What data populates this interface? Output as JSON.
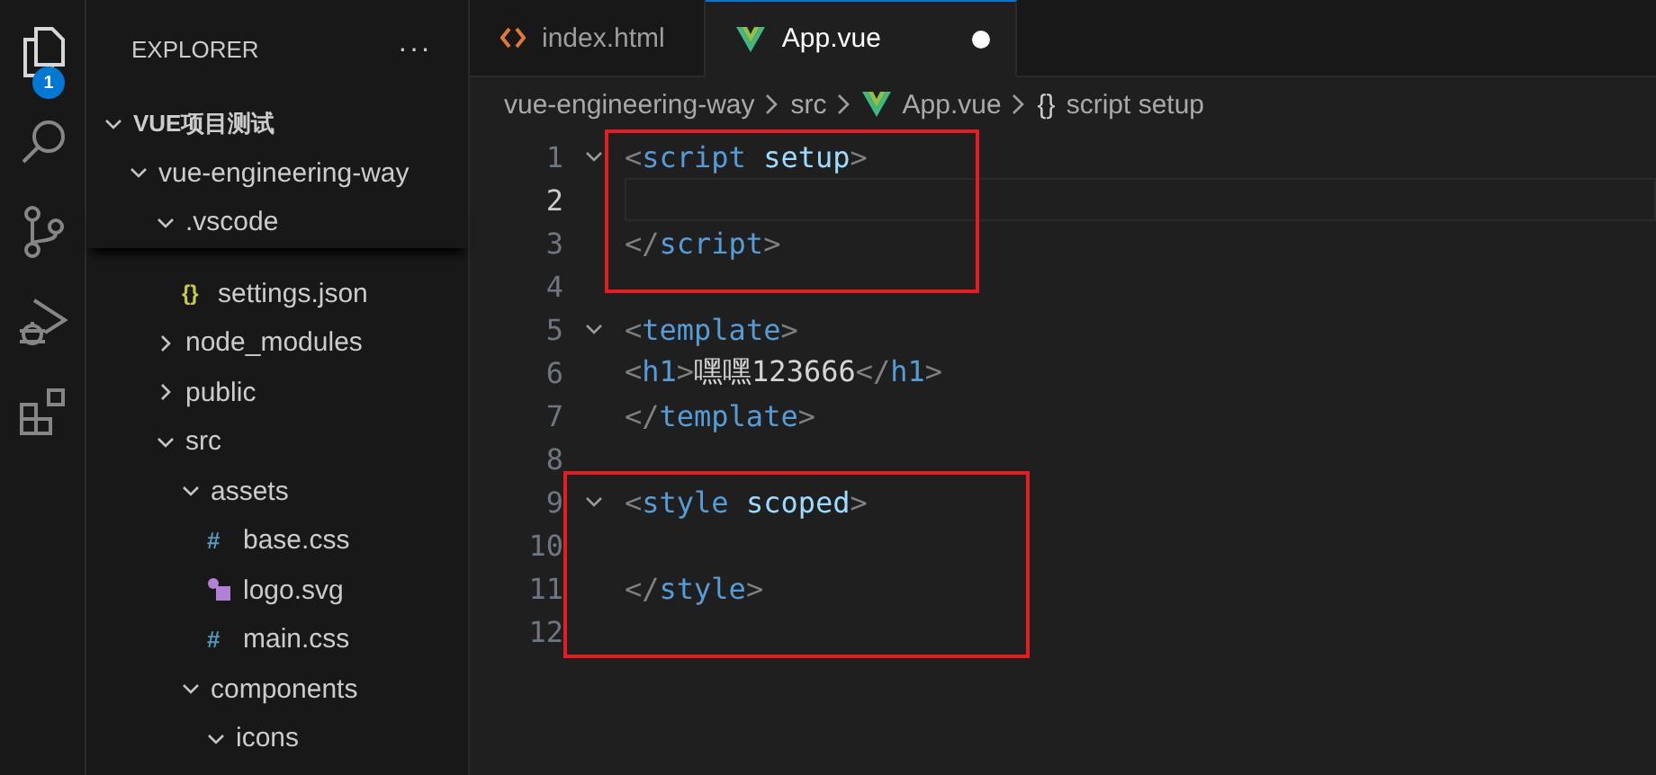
{
  "activity_bar": [
    {
      "kind": "files",
      "selected": true,
      "badge": "1"
    },
    {
      "kind": "search",
      "selected": false
    },
    {
      "kind": "source-control",
      "selected": false
    },
    {
      "kind": "run-debug",
      "selected": false
    },
    {
      "kind": "extensions",
      "selected": false
    }
  ],
  "sidebar": {
    "title": "EXPLORER",
    "more": "···",
    "tree": [
      {
        "label": "VUE项目测试",
        "kind": "folder",
        "expanded": true,
        "children": [
          {
            "label": "vue-engineering-way",
            "kind": "folder",
            "expanded": true,
            "children": [
              {
                "label": ".vscode",
                "kind": "folder",
                "expanded": true,
                "children": [
                  {
                    "label": "settings.json",
                    "kind": "json",
                    "icon_text": "{}"
                  }
                ]
              },
              {
                "label": "node_modules",
                "kind": "folder",
                "expanded": false
              },
              {
                "label": "public",
                "kind": "folder",
                "expanded": false
              },
              {
                "label": "src",
                "kind": "folder",
                "expanded": true,
                "children": [
                  {
                    "label": "assets",
                    "kind": "folder",
                    "expanded": true,
                    "children": [
                      {
                        "label": "base.css",
                        "kind": "css",
                        "icon_text": "#"
                      },
                      {
                        "label": "logo.svg",
                        "kind": "svg"
                      },
                      {
                        "label": "main.css",
                        "kind": "css",
                        "icon_text": "#"
                      }
                    ]
                  },
                  {
                    "label": "components",
                    "kind": "folder",
                    "expanded": true,
                    "children": [
                      {
                        "label": "icons",
                        "kind": "folder",
                        "expanded": true
                      }
                    ]
                  }
                ]
              }
            ]
          }
        ]
      }
    ]
  },
  "tabs": [
    {
      "label": "index.html",
      "kind": "html",
      "selected": false,
      "modified": false
    },
    {
      "label": "App.vue",
      "kind": "vue",
      "selected": true,
      "modified": true
    }
  ],
  "breadcrumb": [
    {
      "label": "vue-engineering-way",
      "kind": "folder"
    },
    {
      "label": "src",
      "kind": "folder"
    },
    {
      "label": "App.vue",
      "kind": "vue"
    },
    {
      "label": "script setup",
      "kind": "symbol",
      "symbol": "{}"
    }
  ],
  "editor": {
    "lines": [
      {
        "number": "1",
        "fold": true,
        "selected": false,
        "annotated": true,
        "tokens": [
          {
            "kind": "punct",
            "text": "<"
          },
          {
            "kind": "tag",
            "text": "script"
          },
          {
            "kind": "attr",
            "text": " setup"
          },
          {
            "kind": "punct",
            "text": ">"
          }
        ]
      },
      {
        "number": "2",
        "fold": false,
        "selected": true,
        "annotated": true
      },
      {
        "number": "3",
        "fold": false,
        "selected": false,
        "annotated": true,
        "tokens": [
          {
            "kind": "punct",
            "text": "</"
          },
          {
            "kind": "tag",
            "text": "script"
          },
          {
            "kind": "punct",
            "text": ">"
          }
        ]
      },
      {
        "number": "4",
        "fold": false,
        "selected": false,
        "annotated": false
      },
      {
        "number": "5",
        "fold": true,
        "selected": false,
        "annotated": false,
        "tokens": [
          {
            "kind": "punct",
            "text": "<"
          },
          {
            "kind": "tag",
            "text": "template"
          },
          {
            "kind": "punct",
            "text": ">"
          }
        ]
      },
      {
        "number": "6",
        "fold": false,
        "selected": false,
        "annotated": false,
        "tokens": [
          {
            "kind": "punct",
            "text": "<"
          },
          {
            "kind": "tag",
            "text": "h1"
          },
          {
            "kind": "punct",
            "text": ">"
          },
          {
            "kind": "text",
            "text": "嘿嘿123666"
          },
          {
            "kind": "punct",
            "text": "</"
          },
          {
            "kind": "tag",
            "text": "h1"
          },
          {
            "kind": "punct",
            "text": ">"
          }
        ]
      },
      {
        "number": "7",
        "fold": false,
        "selected": false,
        "annotated": false,
        "tokens": [
          {
            "kind": "punct",
            "text": "</"
          },
          {
            "kind": "tag",
            "text": "template"
          },
          {
            "kind": "punct",
            "text": ">"
          }
        ]
      },
      {
        "number": "8",
        "fold": false,
        "selected": false,
        "annotated": false
      },
      {
        "number": "9",
        "fold": true,
        "selected": false,
        "annotated": true,
        "tokens": [
          {
            "kind": "punct",
            "text": "<"
          },
          {
            "kind": "tag",
            "text": "style"
          },
          {
            "kind": "attr",
            "text": " scoped"
          },
          {
            "kind": "punct",
            "text": ">"
          }
        ]
      },
      {
        "number": "10",
        "fold": false,
        "selected": false,
        "annotated": true
      },
      {
        "number": "11",
        "fold": false,
        "selected": false,
        "annotated": true,
        "tokens": [
          {
            "kind": "punct",
            "text": "</"
          },
          {
            "kind": "tag",
            "text": "style"
          },
          {
            "kind": "punct",
            "text": ">"
          }
        ]
      },
      {
        "number": "12",
        "fold": false,
        "selected": false,
        "annotated": true
      }
    ]
  }
}
